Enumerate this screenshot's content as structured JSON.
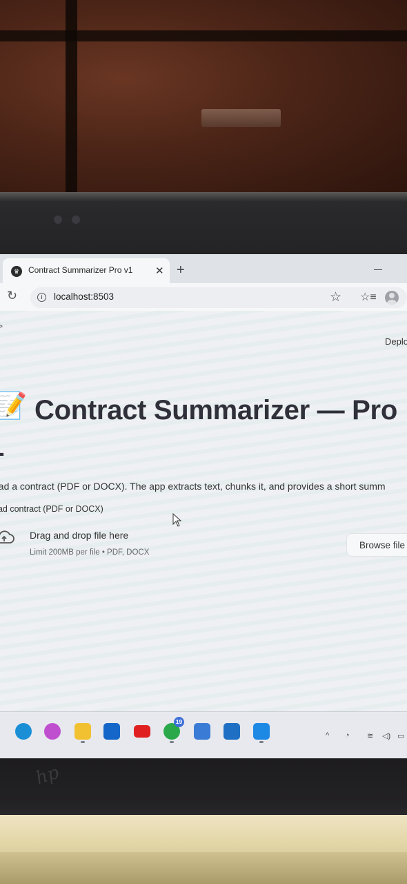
{
  "browser": {
    "tab": {
      "title": "Contract Summarizer Pro v1",
      "close_glyph": "✕",
      "favicon": "streamlit-crown-icon"
    },
    "new_tab_glyph": "+",
    "toolbar": {
      "reload_glyph": "C",
      "url": "localhost:8503",
      "info_glyph": "i",
      "star_glyph": "☆",
      "favorites_glyph": "☆≡"
    }
  },
  "app": {
    "deploy_label": "Deplo",
    "sidebar_chevron": ">",
    "title_icon": "📝",
    "title_line1": "Contract Summarizer — Pro",
    "title_line2": "1",
    "description": "oad a contract (PDF or DOCX). The app extracts text, chunks it, and provides a short summ",
    "uploader": {
      "label": "oad contract (PDF or DOCX)",
      "drop_title": "Drag and drop file here",
      "limit": "Limit 200MB per file • PDF, DOCX",
      "browse_label": "Browse file"
    }
  },
  "taskbar": {
    "apps": [
      {
        "name": "edge-icon",
        "color": "#1b8fd6"
      },
      {
        "name": "copilot-icon",
        "color": "#c04fd0"
      },
      {
        "name": "file-explorer-icon",
        "color": "#f2c132"
      },
      {
        "name": "outlook-icon",
        "color": "#1466c8"
      },
      {
        "name": "youtube-icon",
        "color": "#e02020"
      },
      {
        "name": "whatsapp-icon",
        "color": "#2aa84a"
      },
      {
        "name": "remote-app-icon",
        "color": "#3a7bd5"
      },
      {
        "name": "photos-icon",
        "color": "#1f6fc4"
      },
      {
        "name": "vscode-icon",
        "color": "#1e88e5"
      }
    ],
    "whatsapp_badge": "19",
    "tray_chevron": "^"
  }
}
